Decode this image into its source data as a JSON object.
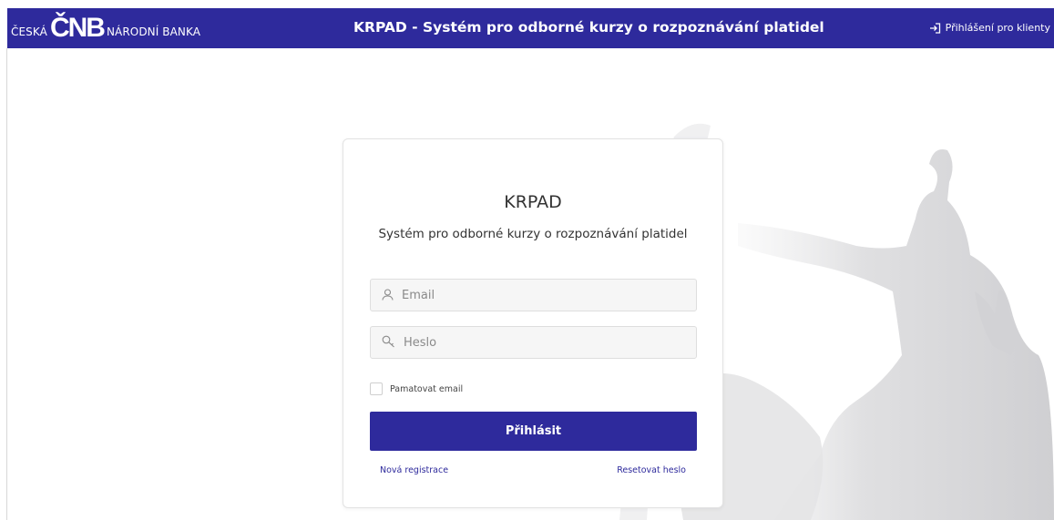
{
  "header": {
    "logo": {
      "left": "ČESKÁ",
      "mark": "ČNB",
      "right": "NÁRODNÍ BANKA"
    },
    "title": "KRPAD - Systém pro odborné kurzy o rozpoznávání platidel",
    "client_login": {
      "label": "Přihlášení pro klienty",
      "icon": "sign-in-icon"
    }
  },
  "login": {
    "title": "KRPAD",
    "subtitle": "Systém pro odborné kurzy o rozpoznávání platidel",
    "email": {
      "placeholder": "Email",
      "value": "",
      "icon": "user-icon"
    },
    "password": {
      "placeholder": "Heslo",
      "value": "",
      "icon": "key-icon"
    },
    "remember": {
      "label": "Pamatovat email",
      "checked": false
    },
    "submit_label": "Přihlásit",
    "register_label": "Nová registrace",
    "reset_label": "Resetovat heslo"
  },
  "colors": {
    "brand": "#2e2a9c",
    "background": "#ffffff",
    "field": "#f6f6f6"
  }
}
